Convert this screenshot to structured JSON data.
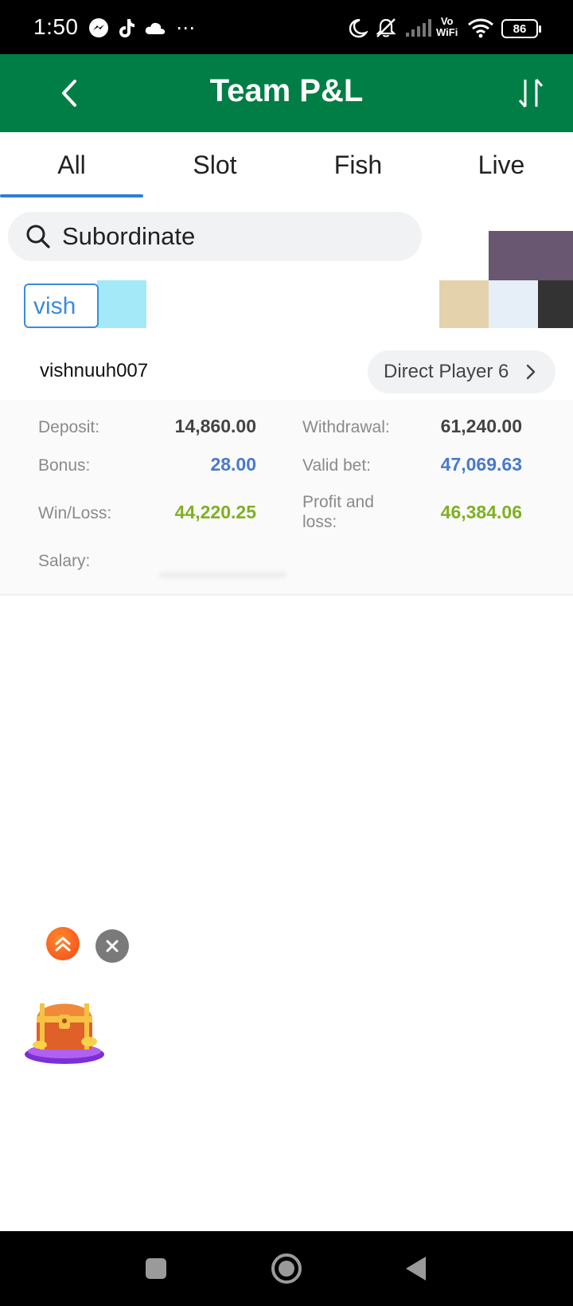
{
  "status_bar": {
    "time": "1:50",
    "battery": "86",
    "vowifi_line1": "Vo",
    "vowifi_line2": "WiFi",
    "icons": [
      "messenger-icon",
      "tiktok-icon",
      "cloud-icon",
      "more-icon",
      "moon-icon",
      "bell-off-icon",
      "signal-icon",
      "wifi-icon",
      "battery-icon"
    ]
  },
  "header": {
    "title": "Team P&L",
    "background": "#017e45"
  },
  "tabs": [
    {
      "label": "All",
      "active": true
    },
    {
      "label": "Slot",
      "active": false
    },
    {
      "label": "Fish",
      "active": false
    },
    {
      "label": "Live",
      "active": false
    }
  ],
  "search": {
    "placeholder": "Subordinate"
  },
  "filter_chip": {
    "text": "vish"
  },
  "record": {
    "username": "vishnuuh007",
    "direct_label": "Direct Player 6",
    "fields": {
      "deposit_label": "Deposit:",
      "deposit_value": "14,860.00",
      "withdrawal_label": "Withdrawal:",
      "withdrawal_value": "61,240.00",
      "bonus_label": "Bonus:",
      "bonus_value": "28.00",
      "valid_bet_label": "Valid bet:",
      "valid_bet_value": "47,069.63",
      "win_loss_label": "Win/Loss:",
      "win_loss_value": "44,220.25",
      "pnl_label_line1": "Profit and",
      "pnl_label_line2": "loss:",
      "pnl_value": "46,384.06",
      "salary_label": "Salary:"
    }
  },
  "colors": {
    "accent_blue": "#2e7fd0",
    "value_blue": "#4a79c9",
    "value_green": "#7fb024"
  }
}
